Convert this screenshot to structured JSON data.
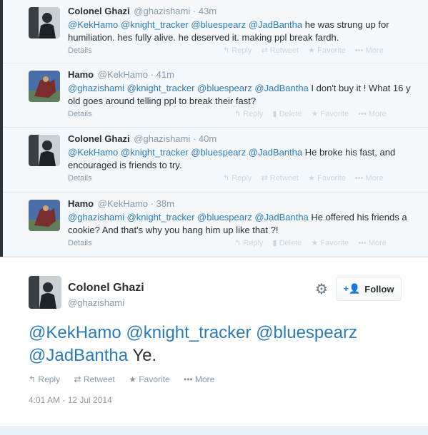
{
  "replies": [
    {
      "name": "Colonel Ghazi",
      "handle": "@ghazishami",
      "time": "43m",
      "mentions": "@KekHamo @knight_tracker @bluespearz @JadBantha",
      "text": " he was strung up for humiliation. hes fully alive. he deserved it. making ppl break fardh.",
      "details": "Details",
      "actions": [
        "Reply",
        "Retweet",
        "Favorite",
        "More"
      ]
    },
    {
      "name": "Hamo",
      "handle": "@KekHamo",
      "time": "41m",
      "mentions": "@ghazishami @knight_tracker @bluespearz @JadBantha",
      "text": " I don't buy it ! What 16 y old goes around telling ppl to break their fast?",
      "details": "Details",
      "actions": [
        "Reply",
        "Delete",
        "Favorite",
        "More"
      ]
    },
    {
      "name": "Colonel Ghazi",
      "handle": "@ghazishami",
      "time": "40m",
      "mentions": "@KekHamo @knight_tracker @bluespearz @JadBantha",
      "text": " He broke his fast, and encouraged is friends to try.",
      "details": "Details",
      "actions": [
        "Reply",
        "Retweet",
        "Favorite",
        "More"
      ]
    },
    {
      "name": "Hamo",
      "handle": "@KekHamo",
      "time": "38m",
      "mentions": "@ghazishami @knight_tracker @bluespearz @JadBantha",
      "text": " He offered his friends a cookie? And that's why you hang him up like that ?!",
      "details": "Details",
      "actions": [
        "Reply",
        "Delete",
        "Favorite",
        "More"
      ]
    }
  ],
  "main": {
    "name": "Colonel Ghazi",
    "handle": "@ghazishami",
    "follow_label": "Follow",
    "mentions_line1": "@KekHamo @knight_tracker @bluespearz",
    "mentions_line2": "@JadBantha",
    "text": " Ye.",
    "actions": [
      "Reply",
      "Retweet",
      "Favorite",
      "More"
    ],
    "timestamp": "4:01 AM - 12 Jul 2014"
  },
  "icons": {
    "reply": "reply-icon",
    "retweet": "retweet-icon",
    "favorite": "star-icon",
    "more": "more-icon",
    "settings": "gear-icon",
    "follow": "add-user-icon"
  },
  "colors": {
    "link": "#2b7bb9",
    "muted": "#8899a6",
    "thread_bg": "#f5f8fa"
  }
}
